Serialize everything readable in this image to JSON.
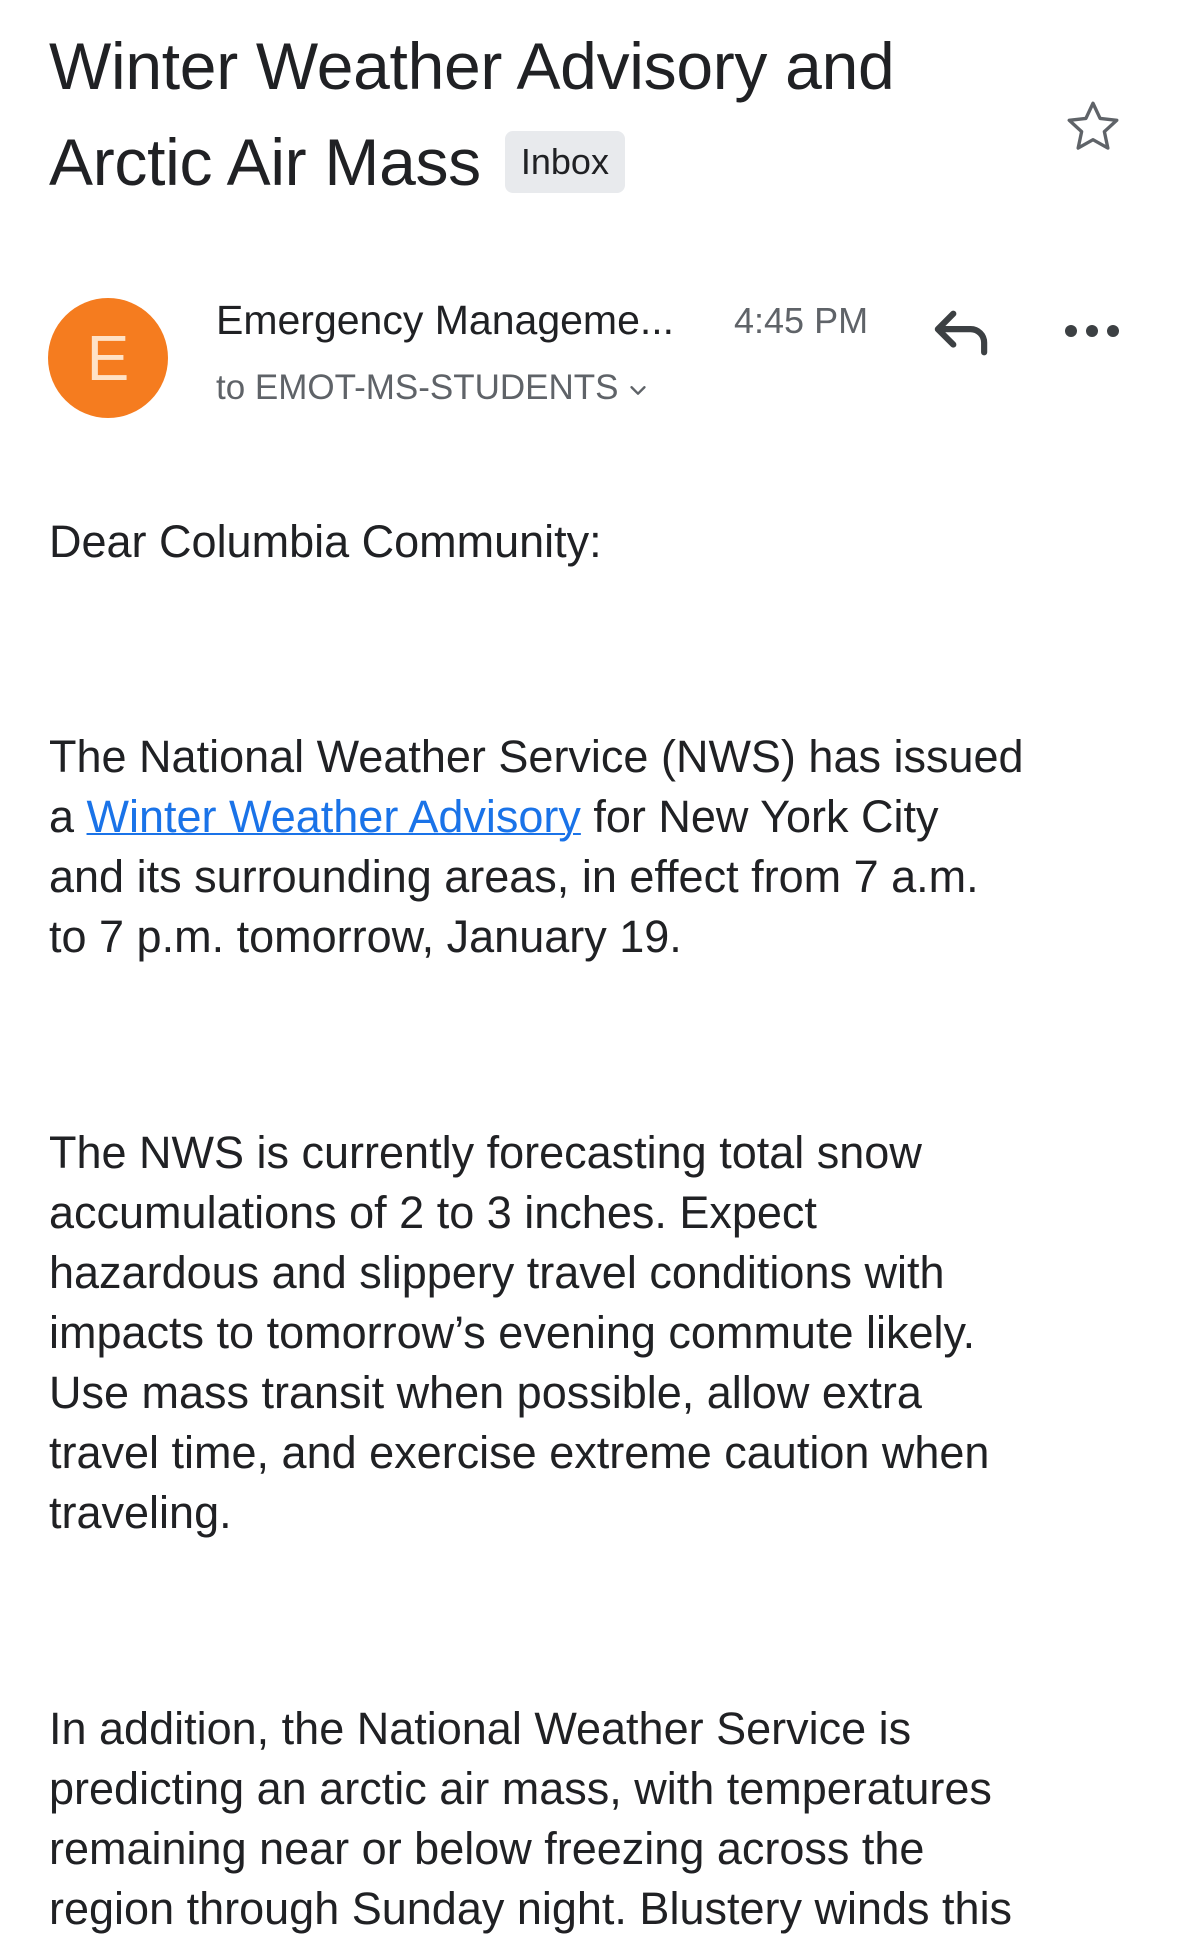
{
  "email": {
    "subject_line1": "Winter Weather Advisory and",
    "subject_line2": "Arctic Air Mass",
    "label": "Inbox",
    "sender_initial": "E",
    "sender_name": "Emergency Manageme...",
    "time": "4:45 PM",
    "recipients": "to EMOT-MS-STUDENTS",
    "avatar_color": "#f57c1f",
    "link_color": "#1a73e8"
  },
  "body": {
    "greeting": "Dear Columbia Community:",
    "p1": {
      "line1": "The National Weather Service (NWS) has issued",
      "line2_prefix": "a ",
      "link_text": "Winter Weather Advisory",
      "line2_suffix": " for New York City",
      "line3": "and its surrounding areas, in effect from 7 a.m.",
      "line4": "to 7 p.m. tomorrow, January 19."
    },
    "p2": {
      "line1": "The NWS is currently forecasting total snow",
      "line2": "accumulations of 2 to 3 inches. Expect",
      "line3": "hazardous and slippery travel conditions with",
      "line4": "impacts to tomorrow’s evening commute likely.",
      "line5": "Use mass transit when possible, allow extra",
      "line6": "travel time, and exercise extreme caution when",
      "line7": "traveling."
    },
    "p3": {
      "line1": "In addition, the National Weather Service is",
      "line2": "predicting an arctic air mass, with temperatures",
      "line3": "remaining near or below freezing across the",
      "line4": "region through Sunday night. Blustery winds this"
    }
  },
  "icons": {
    "star": "star-outline-icon",
    "reply": "reply-icon",
    "more": "more-horizontal-icon",
    "chevron": "chevron-down-icon"
  }
}
